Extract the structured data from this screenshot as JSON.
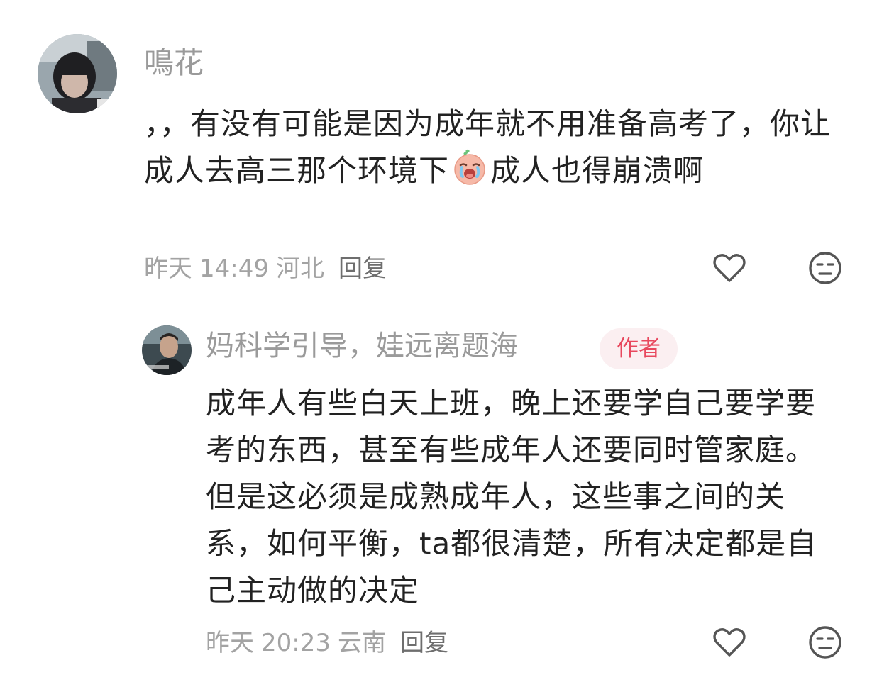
{
  "comments": [
    {
      "username": "鳴花",
      "text_before_emoji": "，，有没有可能是因为成年就不用准备高考了，你让成人去高三那个环境下",
      "emoji": "crying-face-emoji",
      "text_after_emoji": "成人也得崩溃啊",
      "date": "昨天",
      "time": "14:49",
      "location": "河北",
      "reply_label": "回复"
    },
    {
      "username": "妈科学引导，娃远离题海",
      "author_badge": "作者",
      "text": "成年人有些白天上班，晚上还要学自己要学要考的东西，甚至有些成年人还要同时管家庭。但是这必须是成熟成年人，这些事之间的关系，如何平衡，ta都很清楚，所有决定都是自己主动做的决定",
      "date": "昨天",
      "time": "20:23",
      "location": "云南",
      "reply_label": "回复"
    }
  ],
  "icons": {
    "like": "heart-outline-icon",
    "dislike": "neutral-face-icon"
  },
  "colors": {
    "text": "#222222",
    "meta": "#a3a3a3",
    "username": "#9a9a9a",
    "badge_text": "#e8485e",
    "badge_bg": "#fbeff1"
  }
}
